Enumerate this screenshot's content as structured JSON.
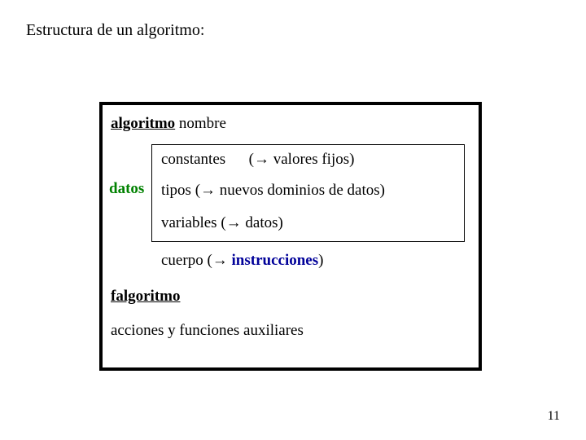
{
  "title": "Estructura de un algoritmo:",
  "box": {
    "algoritmo_kw": "algoritmo",
    "nombre": "nombre",
    "datos_label": "datos",
    "constantes": "constantes",
    "constantes_note_open": "(",
    "arrow": "→",
    "constantes_note_text": " valores fijos)",
    "tipos": "tipos",
    "tipos_note_open": "   (",
    "tipos_note_text": " nuevos dominios de datos)",
    "variables": "variables",
    "variables_note_open": "    (",
    "variables_note_text": " datos)",
    "cuerpo": "cuerpo",
    "cuerpo_note_open": "    (",
    "instrucciones": " instrucciones",
    "cuerpo_note_close": ")",
    "falgoritmo": "falgoritmo",
    "acciones": "acciones y funciones auxiliares"
  },
  "page_number": "11"
}
